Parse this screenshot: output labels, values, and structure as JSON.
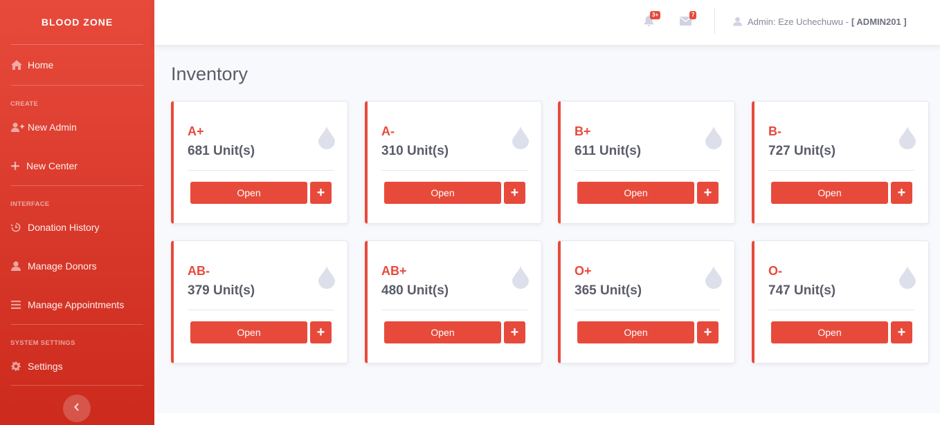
{
  "sidebar": {
    "brand": "BLOOD ZONE",
    "home": "Home",
    "sections": {
      "create": "CREATE",
      "interface": "INTERFACE",
      "system": "SYSTEM SETTINGS"
    },
    "items": {
      "new_admin": "New Admin",
      "new_center": "New Center",
      "donation_history": "Donation History",
      "manage_donors": "Manage Donors",
      "manage_appointments": "Manage Appointments",
      "settings": "Settings"
    }
  },
  "topbar": {
    "alerts_badge": "3+",
    "messages_badge": "7",
    "user_label": "Admin: Eze Uchechuwu -",
    "user_id": "[ ADMIN201 ]"
  },
  "page": {
    "title": "Inventory"
  },
  "cards": [
    {
      "type": "A+",
      "units": "681 Unit(s)",
      "open": "Open",
      "plus": "+"
    },
    {
      "type": "A-",
      "units": "310 Unit(s)",
      "open": "Open",
      "plus": "+"
    },
    {
      "type": "B+",
      "units": "611 Unit(s)",
      "open": "Open",
      "plus": "+"
    },
    {
      "type": "B-",
      "units": "727 Unit(s)",
      "open": "Open",
      "plus": "+"
    },
    {
      "type": "AB-",
      "units": "379 Unit(s)",
      "open": "Open",
      "plus": "+"
    },
    {
      "type": "AB+",
      "units": "480 Unit(s)",
      "open": "Open",
      "plus": "+"
    },
    {
      "type": "O+",
      "units": "365 Unit(s)",
      "open": "Open",
      "plus": "+"
    },
    {
      "type": "O-",
      "units": "747 Unit(s)",
      "open": "Open",
      "plus": "+"
    }
  ],
  "colors": {
    "primary": "#e74a3b",
    "text_dark": "#5a5c69",
    "muted": "#858796",
    "background": "#f8f9fc"
  }
}
